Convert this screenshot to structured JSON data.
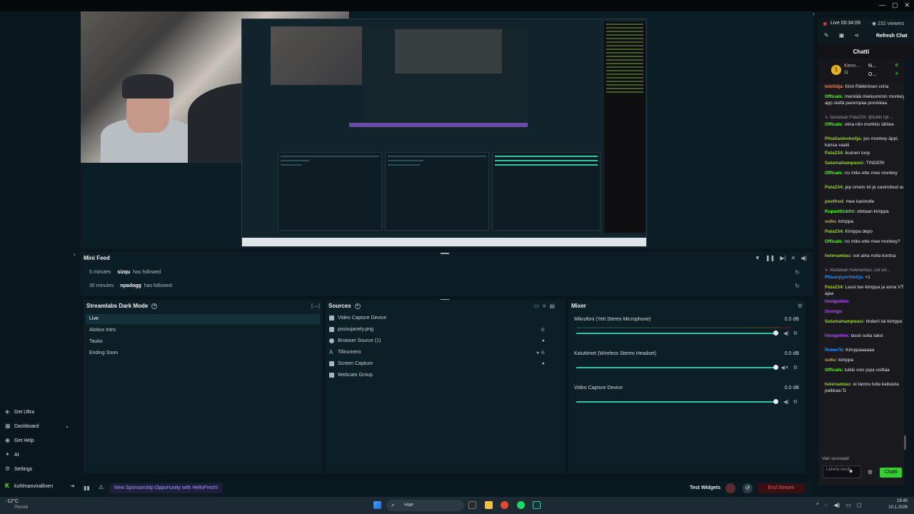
{
  "window": {
    "controls": [
      "—",
      "▢",
      "✕"
    ]
  },
  "minifeed": {
    "title": "Mini Feed",
    "events": [
      {
        "time": "5 minutes",
        "user": "sizqu",
        "action": "has followed"
      },
      {
        "time": "30 minutes",
        "user": "npadogg",
        "action": "has followed"
      }
    ]
  },
  "scenes": {
    "title": "Streamlabs Dark Mode",
    "items": [
      "Live",
      "Aloitus Intro",
      "Tauko",
      "Ending Soon"
    ]
  },
  "sources": {
    "title": "Sources",
    "items": [
      "Video Capture Device",
      "possujanely.png",
      "Browser Source (1)",
      "Tilinumero",
      "Screen Capture",
      "Webcam Group"
    ]
  },
  "mixer": {
    "title": "Mixer",
    "items": [
      {
        "name": "Mikrofoni (Yeti Stereo Microphone)",
        "db": "0.0 dB",
        "level": 1.0
      },
      {
        "name": "Kaiuttimet (Wireless Stereo Headset)",
        "db": "0.0 dB",
        "level": 1.0
      },
      {
        "name": "Video Capture Device",
        "db": "0.0 dB",
        "level": 1.0
      }
    ]
  },
  "nav": {
    "get_ultra": "Get Ultra",
    "dashboard": "Dashboard",
    "get_help": "Get Help",
    "ai": "AI",
    "settings": "Settings",
    "username": "kuhlmanvirallinen"
  },
  "status": {
    "sponsor": "New Sponsorship Opportunity with HelloFresh!",
    "test_widgets": "Test Widgets",
    "end_stream": "End Stream"
  },
  "chat": {
    "live": "Live 00:34:09",
    "viewers": "232 viewers",
    "refresh": "Refresh Chat",
    "title": "Chatti",
    "top1_name": "Kenn...",
    "top1_val": "11",
    "top2_name": "N...",
    "top2_val": "6",
    "top3_name": "O...",
    "top3_val": "4",
    "messages": [
      {
        "user": "tobOdja:",
        "text": "Kimi Räikkönen vcha",
        "color": "#ff7f50"
      },
      {
        "user": "Officals:",
        "text": "menkää mieluummin monkey app siellä parempaa porukkaa",
        "color": "#9acd32"
      },
      {
        "reply": "Vastataan Pata234: @luikki nyt ..."
      },
      {
        "user": "Officals:",
        "text": "viina niin morkkis lähtee",
        "color": "#9acd32"
      },
      {
        "user": "Pihallaoleskelija:",
        "text": "joo monkey äppi, kansa vaatii",
        "color": "#9acd32"
      },
      {
        "user": "Pata234:",
        "text": "ikuinen loop",
        "color": "#9acd32"
      },
      {
        "user": "Satamahampuusi:",
        "text": "TINDERI",
        "color": "#9acd32"
      },
      {
        "user": "Officals:",
        "text": "no miks ette mee monkey",
        "color": "#9acd32"
      },
      {
        "user": "Pata234:",
        "text": "jep ometv kii ja casinobud auki",
        "color": "#9acd32"
      },
      {
        "user": "peetfred:",
        "text": "mee kasinolle",
        "color": "#9acd32"
      },
      {
        "user": "KupariGoblin:",
        "text": "otetaan kimppa",
        "color": "#9acd32"
      },
      {
        "user": "su6u:",
        "text": "kimppa",
        "color": "#daa520"
      },
      {
        "user": "Pata234:",
        "text": "Kimppa depo",
        "color": "#9acd32"
      },
      {
        "user": "Officals:",
        "text": "no miks ette mee monkey?",
        "color": "#9acd32"
      },
      {
        "user": "helenamiau:",
        "text": "oot aina nolla kontsa",
        "color": "#9acd32"
      },
      {
        "reply": "Vastataan helenamiau: oot ain..."
      },
      {
        "user": "Pitsanpyorittelija:",
        "text": "+1",
        "color": "#1e90ff"
      },
      {
        "user": "Pata234:",
        "text": "Lassi tee kimppa ja anna VT:N ajaa",
        "color": "#9acd32"
      },
      {
        "user": "hiisigoblin:",
        "text": "",
        "color": "#b34dff"
      },
      {
        "user": "Scongs:",
        "text": "",
        "color": "#b34dff"
      },
      {
        "user": "Satamahampuusi:",
        "text": "tinderii tai kimppa",
        "color": "#9acd32"
      },
      {
        "user": "hiisigoblin:",
        "text": "lassii soita taksi",
        "color": "#b34dff"
      },
      {
        "user": "Rome76:",
        "text": "Kimppaaaaaa",
        "color": "#1e90ff"
      },
      {
        "user": "su6u:",
        "text": "kimppa",
        "color": "#daa520"
      },
      {
        "user": "Officals:",
        "text": "luikki vois jopa voittaa",
        "color": "#9acd32"
      },
      {
        "user": "helenamiau:",
        "text": "ei tainnu tulla keikasta palkkaa:'D",
        "color": "#9acd32"
      }
    ],
    "followers_only": "Vain seuraajat",
    "input_placeholder": "Lähetä viesti",
    "send": "Chatti"
  },
  "taskbar": {
    "weather_temp": "-12°C",
    "weather_desc": "Pilvistä",
    "search": "Hae",
    "time": "18.45",
    "date": "10.1.2026"
  },
  "colors": {
    "accent": "#31c3a2",
    "end_stream": "#ff5252",
    "send": "#31d12e"
  }
}
